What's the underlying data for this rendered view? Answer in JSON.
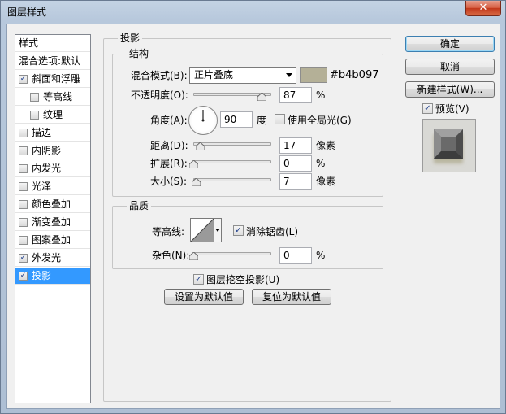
{
  "window": {
    "title": "图层样式",
    "close_glyph": "✕"
  },
  "style_list": {
    "items": [
      {
        "label": "样式",
        "has_checkbox": false,
        "checked": false,
        "indent": false,
        "selected": false
      },
      {
        "label": "混合选项:默认",
        "has_checkbox": false,
        "checked": false,
        "indent": false,
        "selected": false
      },
      {
        "label": "斜面和浮雕",
        "has_checkbox": true,
        "checked": true,
        "indent": false,
        "selected": false
      },
      {
        "label": "等高线",
        "has_checkbox": true,
        "checked": false,
        "indent": true,
        "selected": false
      },
      {
        "label": "纹理",
        "has_checkbox": true,
        "checked": false,
        "indent": true,
        "selected": false
      },
      {
        "label": "描边",
        "has_checkbox": true,
        "checked": false,
        "indent": false,
        "selected": false
      },
      {
        "label": "内阴影",
        "has_checkbox": true,
        "checked": false,
        "indent": false,
        "selected": false
      },
      {
        "label": "内发光",
        "has_checkbox": true,
        "checked": false,
        "indent": false,
        "selected": false
      },
      {
        "label": "光泽",
        "has_checkbox": true,
        "checked": false,
        "indent": false,
        "selected": false
      },
      {
        "label": "颜色叠加",
        "has_checkbox": true,
        "checked": false,
        "indent": false,
        "selected": false
      },
      {
        "label": "渐变叠加",
        "has_checkbox": true,
        "checked": false,
        "indent": false,
        "selected": false
      },
      {
        "label": "图案叠加",
        "has_checkbox": true,
        "checked": false,
        "indent": false,
        "selected": false
      },
      {
        "label": "外发光",
        "has_checkbox": true,
        "checked": true,
        "indent": false,
        "selected": false
      },
      {
        "label": "投影",
        "has_checkbox": true,
        "checked": true,
        "indent": false,
        "selected": true
      }
    ]
  },
  "drop_shadow": {
    "title": "投影",
    "structure": {
      "title": "结构",
      "blend_mode_label": "混合模式(B):",
      "blend_mode_value": "正片叠底",
      "color_hex": "#b4b097",
      "opacity_label": "不透明度(O):",
      "opacity_value": "87",
      "opacity_fraction": 0.87,
      "opacity_unit": "%",
      "angle_label": "角度(A):",
      "angle_value": "90",
      "angle_unit": "度",
      "global_light_label": "使用全局光(G)",
      "global_light_checked": false,
      "distance_label": "距离(D):",
      "distance_value": "17",
      "distance_fraction": 0.08,
      "distance_unit": "像素",
      "spread_label": "扩展(R):",
      "spread_value": "0",
      "spread_fraction": 0.0,
      "spread_unit": "%",
      "size_label": "大小(S):",
      "size_value": "7",
      "size_fraction": 0.03,
      "size_unit": "像素"
    },
    "quality": {
      "title": "品质",
      "contour_label": "等高线:",
      "antialias_label": "消除锯齿(L)",
      "antialias_checked": true,
      "noise_label": "杂色(N):",
      "noise_value": "0",
      "noise_fraction": 0.0,
      "noise_unit": "%"
    },
    "knockout_label": "图层挖空投影(U)",
    "knockout_checked": true,
    "make_default_label": "设置为默认值",
    "reset_default_label": "复位为默认值"
  },
  "buttons": {
    "ok": "确定",
    "cancel": "取消",
    "new_style": "新建样式(W)...",
    "preview_label": "预览(V)",
    "preview_checked": true
  },
  "check_glyph": "✓"
}
